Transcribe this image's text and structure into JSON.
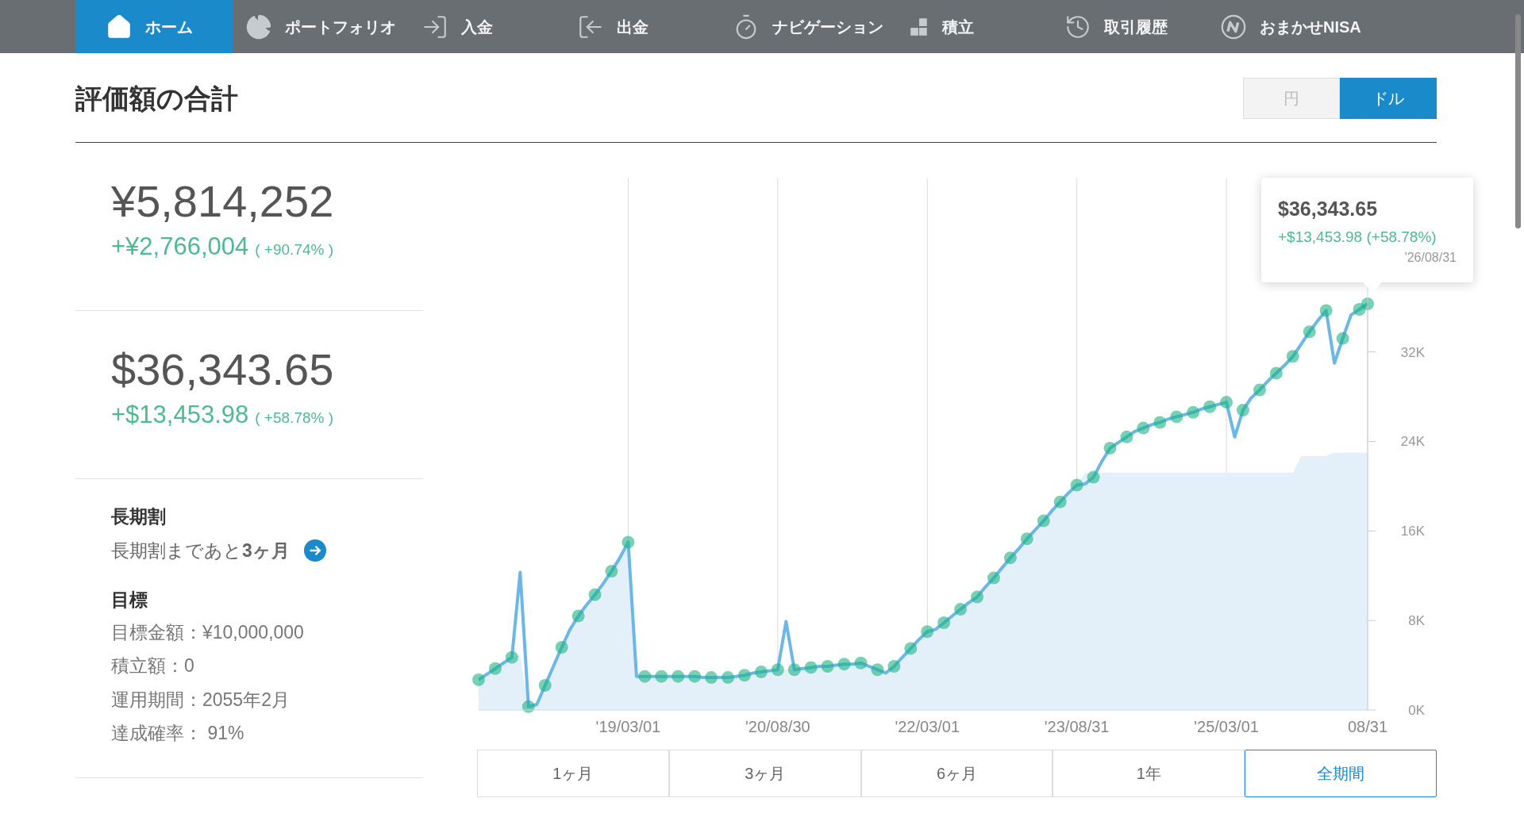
{
  "nav": [
    {
      "label": "ホーム",
      "kind": "home",
      "selected": true
    },
    {
      "label": "ポートフォリオ",
      "kind": "pie",
      "selected": false
    },
    {
      "label": "入金",
      "kind": "deposit",
      "selected": false
    },
    {
      "label": "出金",
      "kind": "withdraw",
      "selected": false
    },
    {
      "label": "ナビゲーション",
      "kind": "dial",
      "selected": false
    },
    {
      "label": "積立",
      "kind": "blocks",
      "selected": false
    },
    {
      "label": "取引履歴",
      "kind": "history",
      "selected": false
    },
    {
      "label": "おまかせNISA",
      "kind": "nisa",
      "selected": false
    }
  ],
  "header": {
    "title": "評価額の合計",
    "currency_toggle": [
      {
        "label": "円",
        "selected": false
      },
      {
        "label": "ドル",
        "selected": true
      }
    ]
  },
  "summary": [
    {
      "amount": "¥5,814,252",
      "gain": "+¥2,766,004",
      "gain_percent": "( +90.74% )"
    },
    {
      "amount": "$36,343.65",
      "gain": "+$13,453.98",
      "gain_percent": "( +58.78% )"
    }
  ],
  "long_term": {
    "heading": "長期割",
    "text": "長期割まであと**3ヶ月**"
  },
  "goal": {
    "heading": "目標",
    "lines": [
      "目標金額：¥10,000,000",
      "積立額：0",
      "運用期間：2055年2月",
      "達成確率： 91%"
    ]
  },
  "chart": {
    "tooltip": {
      "value": "$36,343.65",
      "gain": "+$13,453.98 (+58.78%)",
      "date": "'26/08/31"
    },
    "chart_data": {
      "type": "line",
      "categories": [
        null,
        null,
        null,
        null,
        null,
        null,
        null,
        null,
        null,
        null,
        null,
        null,
        null,
        null,
        null,
        null,
        null,
        null,
        "'19/03/01",
        null,
        null,
        null,
        null,
        null,
        null,
        null,
        null,
        null,
        null,
        null,
        null,
        null,
        null,
        null,
        null,
        null,
        "'20/08/30",
        null,
        null,
        null,
        null,
        null,
        null,
        null,
        null,
        null,
        null,
        null,
        null,
        null,
        null,
        null,
        null,
        null,
        "'22/03/01",
        null,
        null,
        null,
        null,
        null,
        null,
        null,
        null,
        null,
        null,
        null,
        null,
        null,
        null,
        null,
        null,
        null,
        "'23/08/31",
        null,
        null,
        null,
        null,
        null,
        null,
        null,
        null,
        null,
        null,
        null,
        null,
        null,
        null,
        null,
        null,
        null,
        "'25/03/01",
        null,
        null,
        null,
        null,
        null,
        null,
        null,
        null,
        null,
        null,
        null,
        null,
        null,
        null,
        null,
        null,
        "08/31"
      ],
      "series": [
        {
          "type": "line",
          "color": "#6bb8e8",
          "values": [
            2.7,
            3.2,
            3.7,
            4.2,
            4.7,
            12.3,
            0.3,
            0.5,
            2.2,
            3.9,
            5.6,
            7.2,
            8.4,
            9.4,
            10.3,
            11.3,
            12.4,
            13.6,
            15.0,
            3.0,
            3.0,
            3.0,
            3.0,
            3.0,
            3.0,
            3.0,
            3.0,
            2.9,
            2.9,
            2.9,
            2.9,
            3.0,
            3.1,
            3.3,
            3.4,
            3.5,
            3.6,
            7.9,
            3.6,
            3.7,
            3.8,
            3.9,
            3.9,
            4.0,
            4.1,
            4.1,
            4.2,
            3.9,
            3.6,
            3.3,
            3.9,
            4.7,
            5.5,
            6.3,
            7.0,
            7.2,
            7.8,
            8.4,
            9.0,
            9.6,
            10.1,
            11.0,
            11.8,
            12.7,
            13.6,
            14.4,
            15.3,
            16.1,
            16.9,
            17.8,
            18.6,
            19.4,
            20.1,
            20.2,
            20.8,
            22.2,
            23.4,
            23.9,
            24.4,
            24.9,
            25.2,
            25.5,
            25.7,
            26.0,
            26.2,
            26.4,
            26.6,
            26.9,
            27.1,
            27.3,
            27.5,
            24.4,
            26.8,
            27.9,
            28.6,
            29.4,
            30.1,
            30.8,
            31.6,
            32.7,
            33.8,
            34.8,
            35.7,
            31.0,
            33.2,
            35.3,
            35.8,
            36.3
          ]
        },
        {
          "type": "area",
          "color": "#e3f0f9",
          "values": [
            2.7,
            3.2,
            3.7,
            4.2,
            4.7,
            4.9,
            0.3,
            0.5,
            2.2,
            3.9,
            5.6,
            7.2,
            8.4,
            9.4,
            10.3,
            11.3,
            12.4,
            13.6,
            15.0,
            3.0,
            3.0,
            3.0,
            3.0,
            3.0,
            3.0,
            3.0,
            3.0,
            2.9,
            2.9,
            2.9,
            2.9,
            3.0,
            3.1,
            3.3,
            3.4,
            3.5,
            3.6,
            3.6,
            3.6,
            3.7,
            3.8,
            3.9,
            3.9,
            4.0,
            4.1,
            4.1,
            4.2,
            3.9,
            3.6,
            3.3,
            3.9,
            4.7,
            5.5,
            6.3,
            7.0,
            7.2,
            7.8,
            8.4,
            9.0,
            9.6,
            10.1,
            11.0,
            11.8,
            12.7,
            13.6,
            14.4,
            15.3,
            16.1,
            16.9,
            17.8,
            18.6,
            19.4,
            20.1,
            21.2,
            21.2,
            21.2,
            21.2,
            21.2,
            21.2,
            21.2,
            21.2,
            21.2,
            21.2,
            21.2,
            21.2,
            21.2,
            21.2,
            21.2,
            21.2,
            21.2,
            21.2,
            21.2,
            21.2,
            21.2,
            21.2,
            21.2,
            21.2,
            21.2,
            21.2,
            22.7,
            22.7,
            22.7,
            22.7,
            23.0,
            23.0,
            23.0,
            23.0,
            23.0
          ]
        }
      ],
      "ylim": [
        0,
        47.5
      ],
      "grid": "x",
      "yticks": [
        {
          "value": 0,
          "label": "0K"
        },
        {
          "value": 8,
          "label": "8K"
        },
        {
          "value": 16,
          "label": "16K"
        },
        {
          "value": 24,
          "label": "24K"
        },
        {
          "value": 32,
          "label": "32K"
        }
      ]
    }
  },
  "periods": [
    {
      "label": "1ヶ月",
      "selected": false
    },
    {
      "label": "3ヶ月",
      "selected": false
    },
    {
      "label": "6ヶ月",
      "selected": false
    },
    {
      "label": "1年",
      "selected": false
    },
    {
      "label": "全期間",
      "selected": true
    }
  ]
}
